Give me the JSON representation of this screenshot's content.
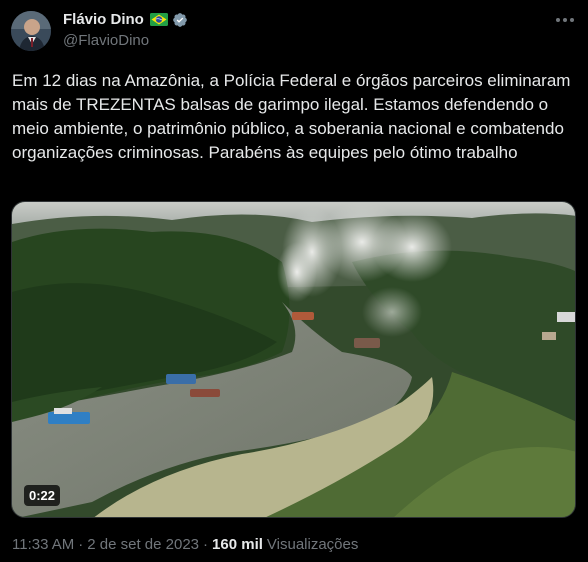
{
  "author": {
    "name": "Flávio Dino",
    "handle": "@FlavioDino",
    "flag_icon": "brazil-flag-icon",
    "verified_icon": "verified-badge-icon",
    "verified_color": "#829aab"
  },
  "tweet": {
    "text": "Em 12 dias na Amazônia, a Polícia Federal e órgãos parceiros eliminaram mais de TREZENTAS balsas de garimpo ilegal. Estamos defendendo o meio ambiente, o patrimônio público, a soberania nacional e combatendo organizações criminosas. Parabéns às equipes pelo ótimo trabalho",
    "video_duration": "0:22"
  },
  "meta": {
    "time": "11:33 AM",
    "separator": "·",
    "date": "2 de set de 2023",
    "views_count": "160 mil",
    "views_label": "Visualizações"
  },
  "colors": {
    "background": "#000000",
    "primary_text": "#e7e9ea",
    "secondary_text": "#71767b",
    "border": "#2f3336"
  }
}
